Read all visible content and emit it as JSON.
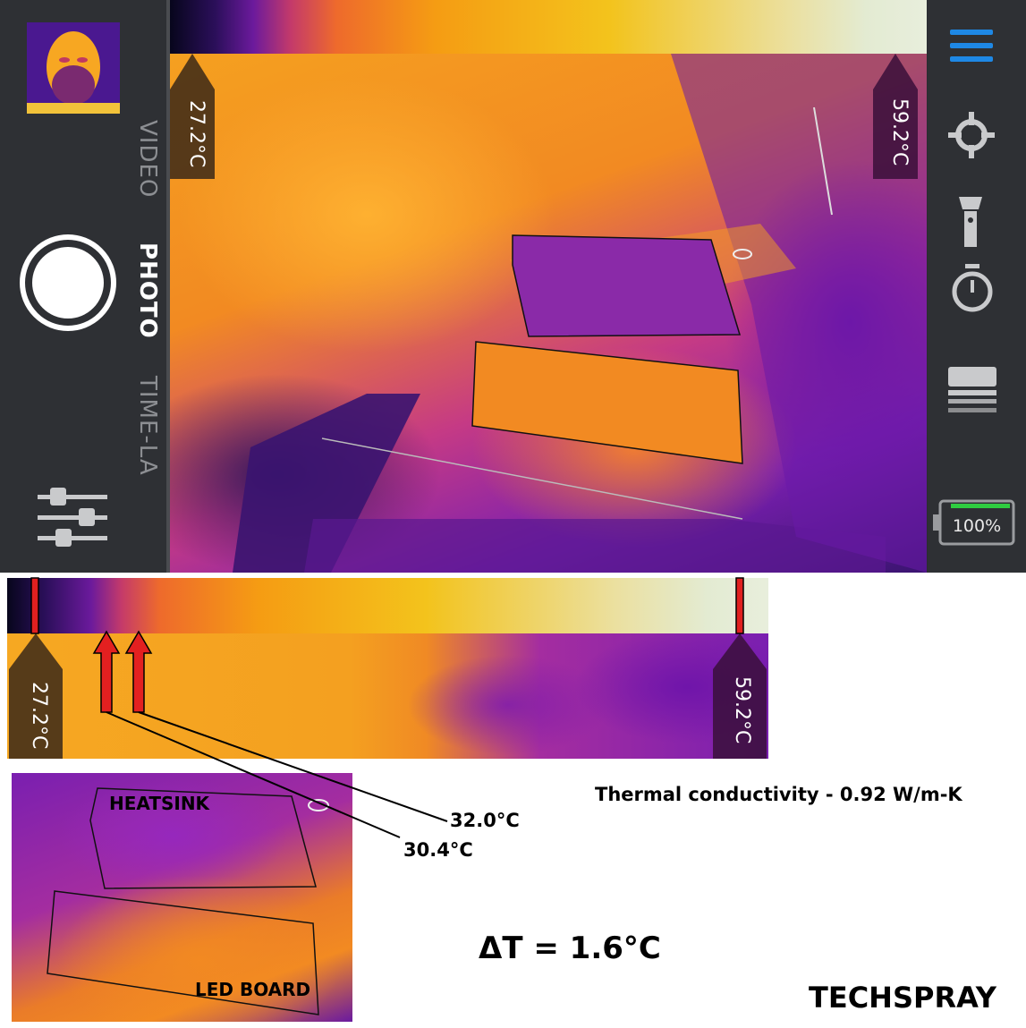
{
  "camera_app": {
    "modes": [
      "VIDEO",
      "PHOTO",
      "TIME-LA"
    ],
    "active_mode": "PHOTO",
    "scale_min": "27.2°C",
    "scale_max": "59.2°C",
    "battery": "100%",
    "icons": [
      "gallery-thumbnail",
      "shutter-button",
      "settings-sliders-icon",
      "hamburger-menu-icon",
      "crosshair-icon",
      "flashlight-icon",
      "timer-icon",
      "layers-icon",
      "battery-icon"
    ],
    "colors": {
      "menu_accent": "#1e88e5",
      "battery_fill": "#2ecc40",
      "panel_bg": "#2e3034"
    }
  },
  "annotated_figure": {
    "scale_min": "27.2°C",
    "scale_max": "59.2°C",
    "heatsink_label": "HEATSINK",
    "led_board_label": "LED BOARD",
    "heatsink_temp": "30.4°C",
    "led_board_temp": "32.0°C",
    "conductivity": "Thermal conductivity - 0.92 W/m-K",
    "delta_t": "ΔT = 1.6°C",
    "brand": "TECHSPRAY"
  }
}
